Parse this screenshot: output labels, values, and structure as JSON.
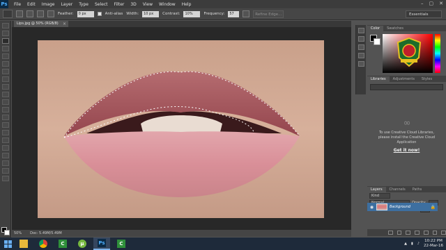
{
  "app": {
    "logo_text": "Ps",
    "menu": [
      "File",
      "Edit",
      "Image",
      "Layer",
      "Type",
      "Select",
      "Filter",
      "3D",
      "View",
      "Window",
      "Help"
    ],
    "window_controls": [
      "–",
      "▢",
      "✕"
    ]
  },
  "options": {
    "feather_label": "Feather:",
    "feather_value": "0 px",
    "antialias_label": "Anti-alias",
    "width_label": "Width:",
    "width_value": "10 px",
    "contrast_label": "Contrast:",
    "contrast_value": "10%",
    "frequency_label": "Frequency:",
    "frequency_value": "57",
    "refine_label": "Refine Edge...",
    "workspace_value": "Essentials"
  },
  "document": {
    "tab_title": "Lips.jpg @ 50% (RGB/8)",
    "zoom": "50%",
    "doc_size": "Doc: 5.49M/5.49M"
  },
  "panels": {
    "color_tabs": [
      "Color",
      "Swatches"
    ],
    "library_tabs": [
      "Libraries",
      "Adjustments",
      "Styles"
    ],
    "library_message": "To use Creative Cloud Libraries, please install the Creative Cloud Application",
    "library_link": "Get it now!",
    "layer_tabs": [
      "Layers",
      "Channels",
      "Paths"
    ],
    "layer_kind": "Kind",
    "blend_mode": "Normal",
    "opacity_label": "Opacity:",
    "fill_label": "Fill:",
    "lock_label": "Lock:",
    "layer_name": "Background"
  },
  "taskbar": {
    "time": "10:22 PM",
    "date": "22-Mar-16"
  },
  "colors": {
    "accent": "#3d6fa0",
    "menubar": "#3c3c3c",
    "taskbar": "#1e2a3a"
  }
}
